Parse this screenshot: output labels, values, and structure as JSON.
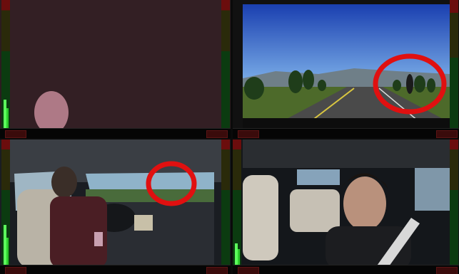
{
  "window": {
    "title": ""
  },
  "panes": [
    {
      "id": "cam-1",
      "view": "dark",
      "left_meter_level": 0.22,
      "right_meter_level": 0
    },
    {
      "id": "cam-2",
      "view": "road-forward",
      "left_meter_level": 0,
      "right_meter_level": 0
    },
    {
      "id": "cam-3",
      "view": "driver-over-shoulder",
      "left_meter_level": 0.32,
      "right_meter_level": 0
    },
    {
      "id": "cam-4",
      "view": "driver-face",
      "left_meter_level": 0.18,
      "right_meter_level": 0
    }
  ],
  "colors": {
    "highlight_circle": "#e01010",
    "meter_green": "#2ecc2e",
    "meter_red": "#6b0d0d"
  }
}
